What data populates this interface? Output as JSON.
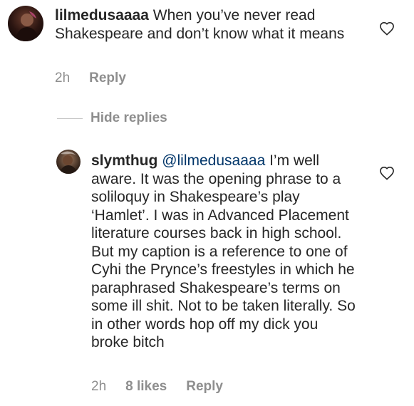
{
  "comments": [
    {
      "username": "lilmedusaaaa",
      "text": "When you’ve never read Shakespeare and don’t know what it means",
      "time": "2h",
      "reply_label": "Reply"
    }
  ],
  "hide_replies_label": "Hide replies",
  "replies": [
    {
      "username": "slymthug",
      "mention": "@lilmedusaaaa",
      "text": "I’m well aware. It was the opening phrase to a soliloquy in Shakespeare’s play ‘Hamlet’. I was in Advanced Placement literature courses back in high school. But my caption is a reference to one of Cyhi the Prynce’s freestyles in which he paraphrased Shakespeare’s terms on some ill shit. Not to be taken literally. So in other words hop off my dick you broke bitch",
      "time": "2h",
      "likes": "8 likes",
      "reply_label": "Reply"
    }
  ],
  "colors": {
    "text": "#262626",
    "secondary": "#8e8e8e",
    "mention": "#003569",
    "divider": "#c7c7c7"
  },
  "icons": {
    "like": "heart-outline-icon"
  }
}
